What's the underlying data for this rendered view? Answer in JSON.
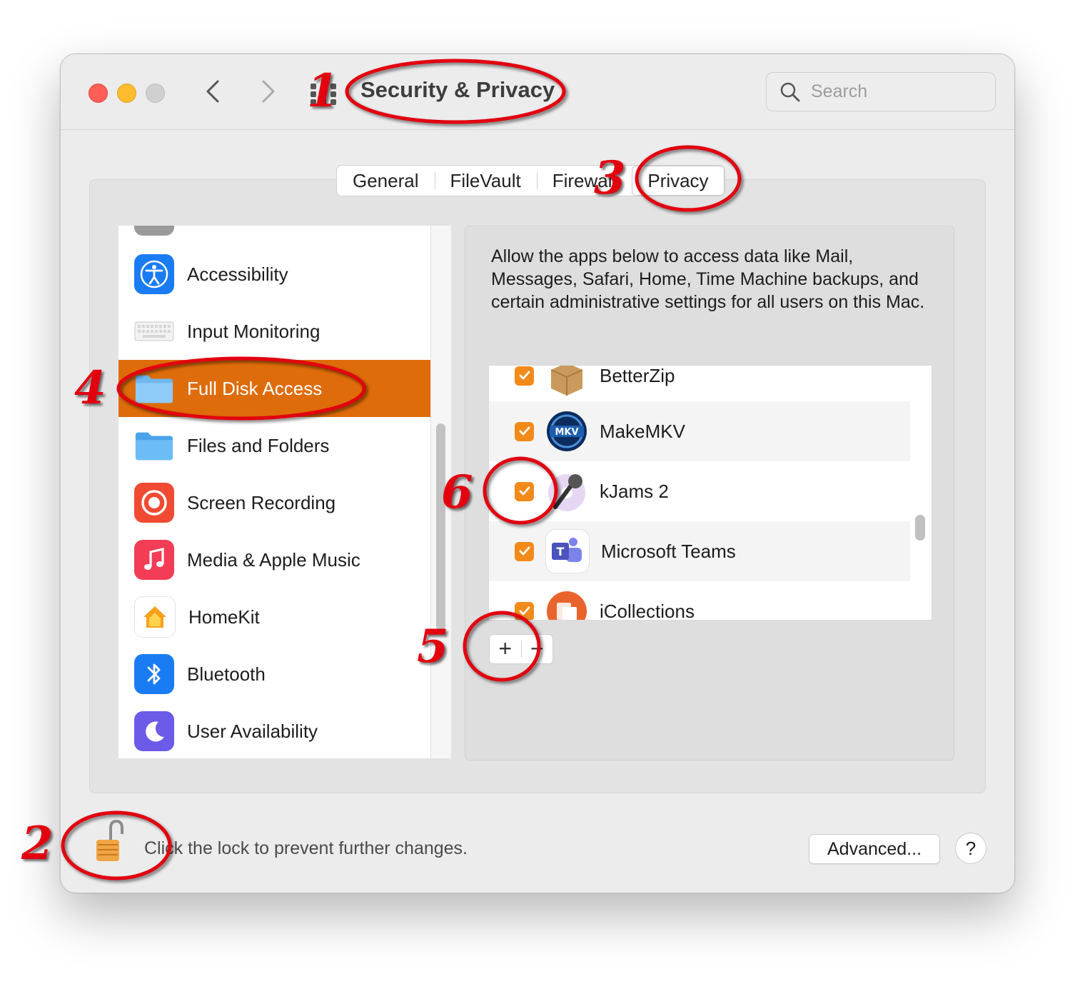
{
  "window": {
    "title": "Security & Privacy",
    "search_placeholder": "Search"
  },
  "tabs": [
    {
      "label": "General"
    },
    {
      "label": "FileVault"
    },
    {
      "label": "Firewall"
    },
    {
      "label": "Privacy",
      "active": true
    }
  ],
  "sidebar": {
    "items": [
      {
        "label": "Accessibility",
        "icon": "accessibility-icon"
      },
      {
        "label": "Input Monitoring",
        "icon": "keyboard-icon"
      },
      {
        "label": "Full Disk Access",
        "icon": "folder-icon",
        "selected": true
      },
      {
        "label": "Files and Folders",
        "icon": "folder-icon"
      },
      {
        "label": "Screen Recording",
        "icon": "screen-recording-icon"
      },
      {
        "label": "Media & Apple Music",
        "icon": "music-note-icon"
      },
      {
        "label": "HomeKit",
        "icon": "home-icon"
      },
      {
        "label": "Bluetooth",
        "icon": "bluetooth-icon"
      },
      {
        "label": "User Availability",
        "icon": "moon-icon"
      }
    ]
  },
  "panel": {
    "description": "Allow the apps below to access data like Mail, Messages, Safari, Home, Time Machine backups, and certain administrative settings for all users on this Mac.",
    "apps": [
      {
        "name": "BetterZip",
        "checked": true
      },
      {
        "name": "MakeMKV",
        "checked": true
      },
      {
        "name": "kJams 2",
        "checked": true
      },
      {
        "name": "Microsoft Teams",
        "checked": true
      },
      {
        "name": "iCollections",
        "checked": true
      }
    ],
    "add_label": "+",
    "remove_label": "−"
  },
  "footer": {
    "lock_text": "Click the lock to prevent further changes.",
    "advanced_label": "Advanced...",
    "help_label": "?"
  },
  "annotations": [
    "1",
    "2",
    "3",
    "4",
    "5",
    "6"
  ],
  "colors": {
    "accent": "#df6c0a",
    "checkbox": "#f28a1a",
    "annotation": "#e2000f"
  }
}
